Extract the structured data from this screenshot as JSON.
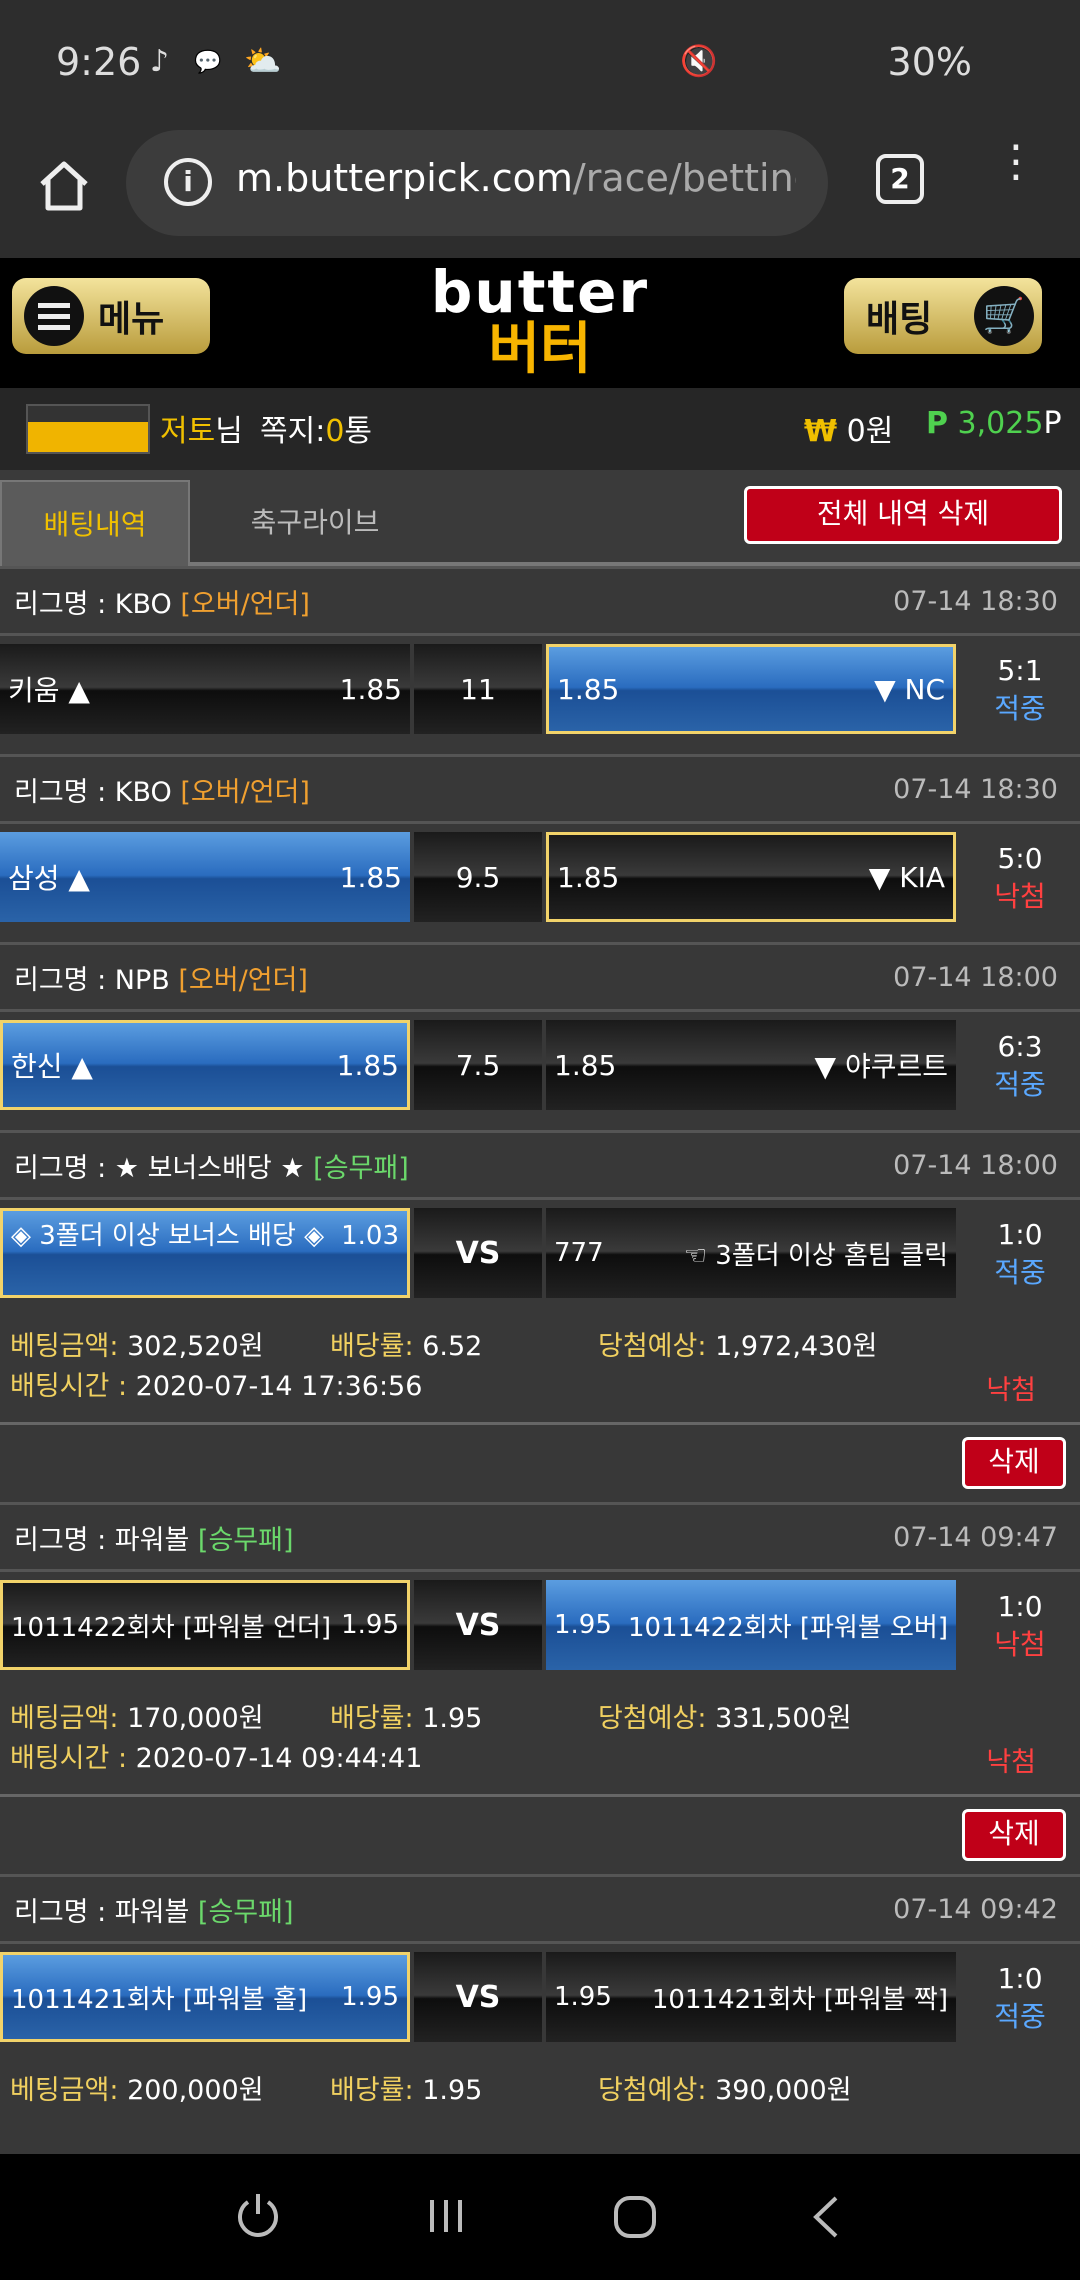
{
  "status": {
    "time": "9:26",
    "battery": "30%"
  },
  "browser": {
    "url_host": "m.butterpick.com",
    "url_path": "/race/betting",
    "tab_count": "2"
  },
  "header": {
    "menu_label": "메뉴",
    "logo_en": "butter",
    "logo_kr": "버터",
    "bet_label": "배팅"
  },
  "user": {
    "name": "저토",
    "honorific": "님",
    "messages_label": "쪽지:",
    "messages_count": "0",
    "messages_unit": "통",
    "won_symbol": "₩",
    "won_value": "0원",
    "points_symbol": "P",
    "points_value": "3,025",
    "points_unit": "P"
  },
  "tabs": {
    "active": "배팅내역",
    "other": "축구라이브",
    "delete_all": "전체 내역 삭제"
  },
  "games": [
    {
      "league": "리그명 : KBO",
      "type": "[오버/언더]",
      "date": "07-14 18:30",
      "home": "키움 ▲",
      "home_odds": "1.85",
      "mid": "11",
      "away_odds": "1.85",
      "away": "▼ NC",
      "score": "5:1",
      "status": "적중"
    },
    {
      "league": "리그명 : KBO",
      "type": "[오버/언더]",
      "date": "07-14 18:30",
      "home": "삼성 ▲",
      "home_odds": "1.85",
      "mid": "9.5",
      "away_odds": "1.85",
      "away": "▼ KIA",
      "score": "5:0",
      "status": "낙첨"
    },
    {
      "league": "리그명 : NPB",
      "type": "[오버/언더]",
      "date": "07-14 18:00",
      "home": "한신 ▲",
      "home_odds": "1.85",
      "mid": "7.5",
      "away_odds": "1.85",
      "away": "▼ 야쿠르트",
      "score": "6:3",
      "status": "적중"
    },
    {
      "league": "리그명 : ★ 보너스배당 ★",
      "type": "[승무패]",
      "date": "07-14 18:00",
      "home": "◈ 3폴더 이상 보너스 배당 ◈",
      "home_odds": "1.03",
      "mid": "VS",
      "away_odds": "777",
      "away": "☜ 3폴더 이상 홈팀 클릭",
      "score": "1:0",
      "status": "적중"
    },
    {
      "league": "리그명 : 파워볼",
      "type": "[승무패]",
      "date": "07-14 09:47",
      "home": "1011422회차 [파워볼 언더]",
      "home_odds": "1.95",
      "mid": "VS",
      "away_odds": "1.95",
      "away": "1011422회차 [파워볼 오버]",
      "score": "1:0",
      "status": "낙첨"
    },
    {
      "league": "리그명 : 파워볼",
      "type": "[승무패]",
      "date": "07-14 09:42",
      "home": "1011421회차 [파워볼 홀]",
      "home_odds": "1.95",
      "mid": "VS",
      "away_odds": "1.95",
      "away": "1011421회차 [파워볼 짝]",
      "score": "1:0",
      "status": "적중"
    }
  ],
  "slips": [
    {
      "amount_label": "베팅금액:",
      "amount": "302,520원",
      "rate_label": "배당률:",
      "rate": "6.52",
      "expected_label": "당첨예상:",
      "expected": "1,972,430원",
      "time_label": "배팅시간 :",
      "time": "2020-07-14 17:36:56",
      "result": "낙첨",
      "delete": "삭제"
    },
    {
      "amount_label": "베팅금액:",
      "amount": "170,000원",
      "rate_label": "배당률:",
      "rate": "1.95",
      "expected_label": "당첨예상:",
      "expected": "331,500원",
      "time_label": "배팅시간 :",
      "time": "2020-07-14 09:44:41",
      "result": "낙첨",
      "delete": "삭제"
    },
    {
      "amount_label": "베팅금액:",
      "amount": "200,000원",
      "rate_label": "배당률:",
      "rate": "1.95",
      "expected_label": "당첨예상:",
      "expected": "390,000원"
    }
  ]
}
